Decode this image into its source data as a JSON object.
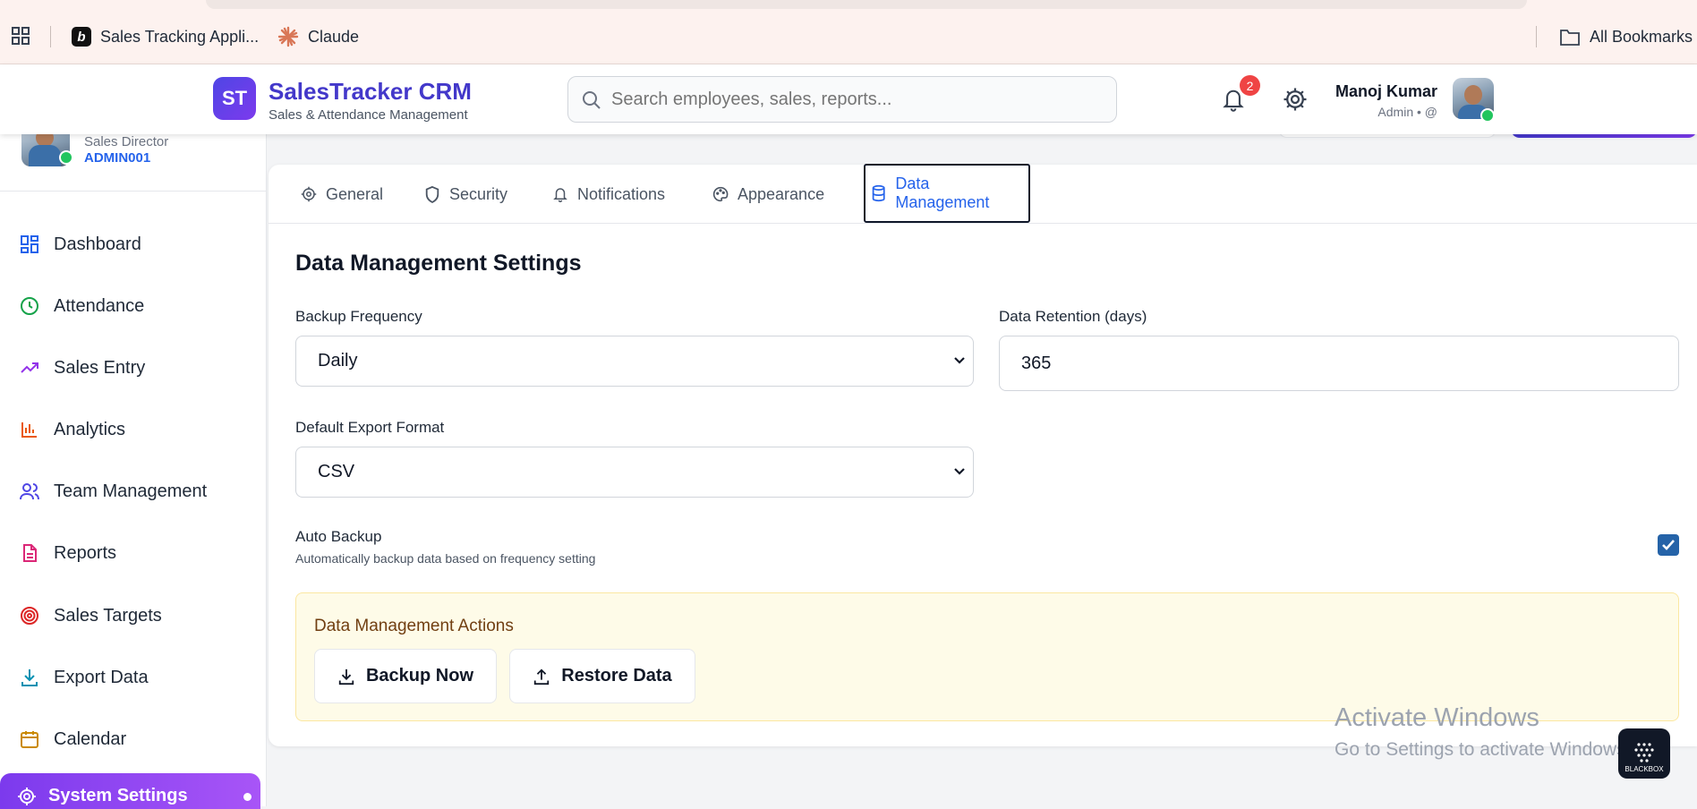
{
  "browser": {
    "bookmarks": [
      {
        "label": "Sales Tracking Appli...",
        "icon": "b-favicon"
      },
      {
        "label": "Claude",
        "icon": "claude-favicon"
      }
    ],
    "all_bookmarks": "All Bookmarks"
  },
  "header": {
    "logo_initials": "ST",
    "title": "SalesTracker CRM",
    "subtitle": "Sales & Attendance Management",
    "search_placeholder": "Search employees, sales, reports...",
    "notification_count": "2",
    "user_name": "Manoj Kumar",
    "user_role": "Admin • @"
  },
  "sidebar": {
    "profile_role": "Sales Director",
    "profile_id": "ADMIN001",
    "items": [
      {
        "label": "Dashboard",
        "icon": "dashboard-icon",
        "color": "#2563eb"
      },
      {
        "label": "Attendance",
        "icon": "clock-icon",
        "color": "#16a34a"
      },
      {
        "label": "Sales Entry",
        "icon": "trending-up-icon",
        "color": "#9333ea"
      },
      {
        "label": "Analytics",
        "icon": "bar-chart-icon",
        "color": "#ea580c"
      },
      {
        "label": "Team Management",
        "icon": "users-icon",
        "color": "#4f46e5"
      },
      {
        "label": "Reports",
        "icon": "document-icon",
        "color": "#db2777"
      },
      {
        "label": "Sales Targets",
        "icon": "target-icon",
        "color": "#dc2626"
      },
      {
        "label": "Export Data",
        "icon": "download-icon",
        "color": "#0891b2"
      },
      {
        "label": "Calendar",
        "icon": "calendar-icon",
        "color": "#ca8a04"
      }
    ],
    "active_item": "System Settings"
  },
  "tabs": [
    {
      "label": "General",
      "icon": "gear-icon"
    },
    {
      "label": "Security",
      "icon": "shield-icon"
    },
    {
      "label": "Notifications",
      "icon": "bell-icon"
    },
    {
      "label": "Appearance",
      "icon": "palette-icon"
    },
    {
      "label": "Data Management",
      "icon": "database-icon",
      "active": true
    }
  ],
  "settings": {
    "title": "Data Management Settings",
    "backup_frequency_label": "Backup Frequency",
    "backup_frequency_value": "Daily",
    "retention_label": "Data Retention (days)",
    "retention_value": "365",
    "export_format_label": "Default Export Format",
    "export_format_value": "CSV",
    "auto_backup_title": "Auto Backup",
    "auto_backup_desc": "Automatically backup data based on frequency setting",
    "auto_backup_checked": true
  },
  "actions": {
    "title": "Data Management Actions",
    "backup_label": "Backup Now",
    "restore_label": "Restore Data"
  },
  "watermark": {
    "line1": "Activate Windows",
    "line2": "Go to Settings to activate Windows.",
    "logo_text": "BLACKBOX"
  },
  "colors": {
    "brand": "#4338ca",
    "accent": "#7c3aed",
    "active_tab": "#2563eb",
    "online": "#22c55e",
    "badge": "#ef4444"
  }
}
